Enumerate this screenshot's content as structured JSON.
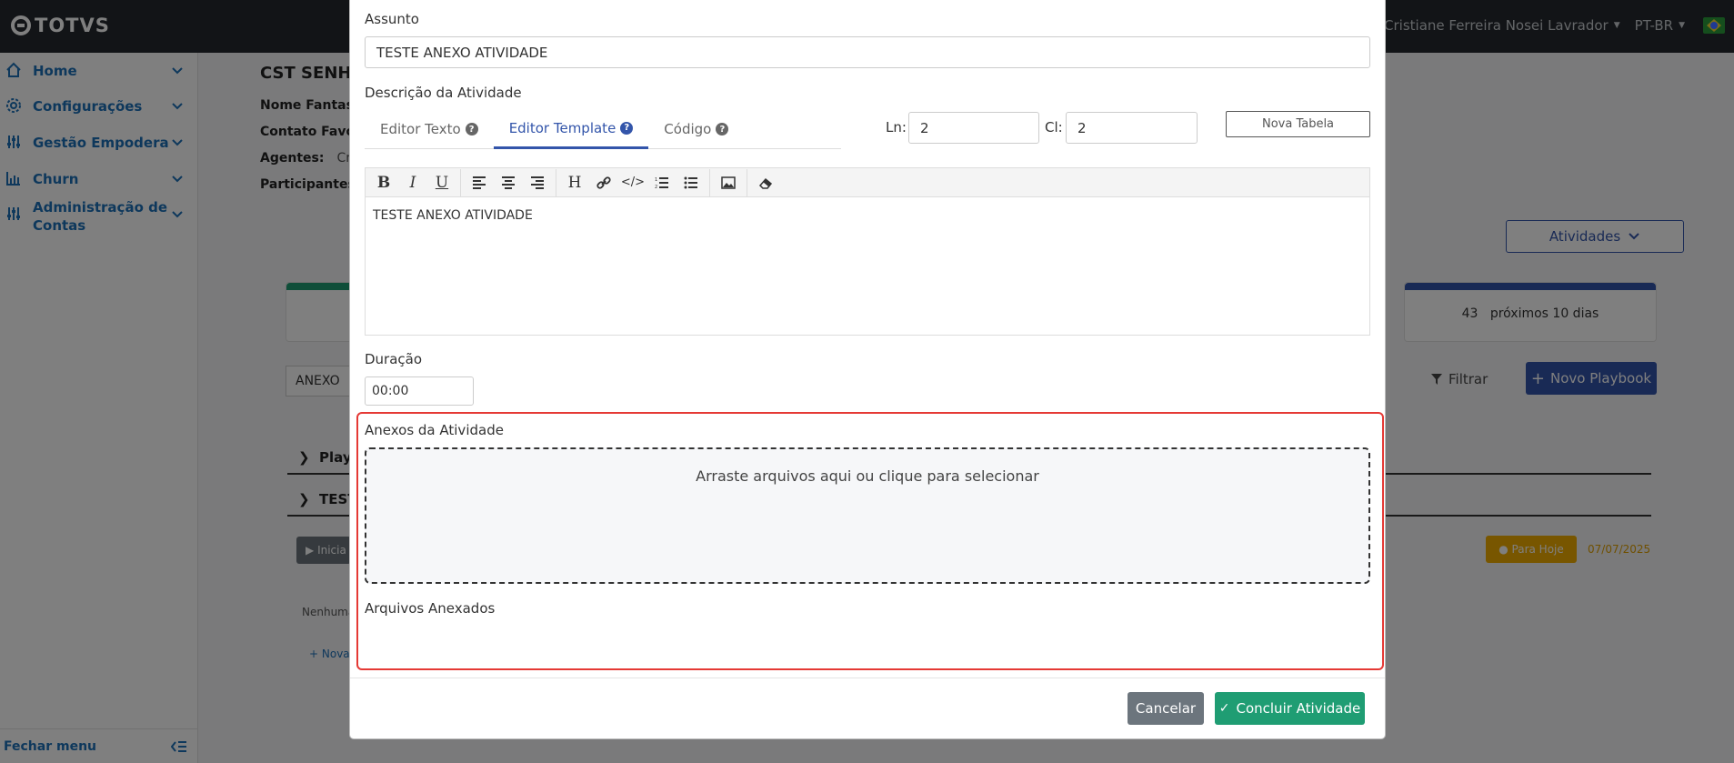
{
  "header": {
    "logo_text": "TOTVS",
    "user_name": "Cristiane Ferreira Nosei Lavrador",
    "language": "PT-BR",
    "flag_icon": "brazil-flag-icon"
  },
  "sidebar": {
    "items": [
      {
        "label": "Home",
        "icon": "home-icon"
      },
      {
        "label": "Configurações",
        "icon": "gear-icon"
      },
      {
        "label": "Gestão Empodera",
        "icon": "sliders-icon"
      },
      {
        "label": "Churn",
        "icon": "bar-chart-icon"
      },
      {
        "label": "Administração de Contas",
        "icon": "sliders-icon"
      }
    ],
    "footer_label": "Fechar menu"
  },
  "background_page": {
    "title": "CST SENHA",
    "fields": [
      {
        "label": "Nome Fantasia",
        "value": ""
      },
      {
        "label": "Contato Favori",
        "value": ""
      },
      {
        "label": "Agentes:",
        "value": "Cri"
      },
      {
        "label": "Participantes:",
        "value": ""
      }
    ],
    "atividades_button": "Atividades",
    "card_count": "43",
    "card_label": "próximos 10 dias",
    "filter_value": "ANEXO",
    "filtrar_label": "Filtrar",
    "novo_playbook_label": "Novo Playbook",
    "row1": "Playb",
    "row2": "TEST",
    "iniciar_label": "Inicia",
    "para_hoje_label": "Para Hoje",
    "date": "07/07/2025",
    "nenhuma_text": "Nenhuma",
    "nova_text": "Nova"
  },
  "modal": {
    "assunto_label": "Assunto",
    "assunto_value": "TESTE ANEXO ATIVIDADE",
    "descricao_label": "Descrição da Atividade",
    "tabs": [
      {
        "label": "Editor Texto",
        "active": false
      },
      {
        "label": "Editor Template",
        "active": true
      },
      {
        "label": "Código",
        "active": false
      }
    ],
    "ln_label": "Ln:",
    "ln_value": "2",
    "cl_label": "Cl:",
    "cl_value": "2",
    "nova_tabela_label": "Nova Tabela",
    "editor_content": "TESTE ANEXO ATIVIDADE",
    "duracao_label": "Duração",
    "duracao_value": "00:00",
    "anexos_label": "Anexos da Atividade",
    "dropzone_text": "Arraste arquivos aqui ou clique para selecionar",
    "arquivos_label": "Arquivos Anexados",
    "cancel_label": "Cancelar",
    "conclude_label": "Concluir Atividade"
  },
  "colors": {
    "primary": "#3355aa",
    "success": "#1f9d73",
    "secondary": "#6c757d",
    "highlight": "#e53935",
    "warning": "#f0ad00"
  }
}
